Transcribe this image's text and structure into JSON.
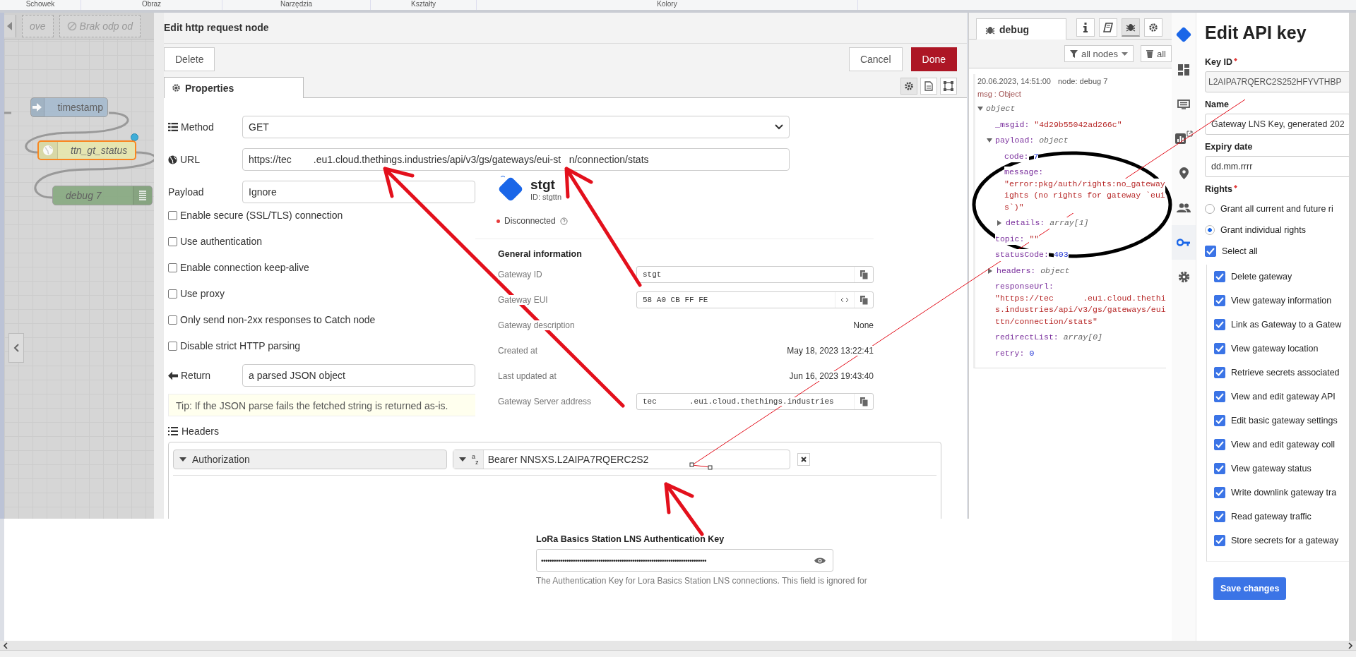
{
  "ribbon": {
    "groups": [
      "Schowek",
      "Obraz",
      "Narzędzia",
      "Kształty",
      "Kolory"
    ]
  },
  "flow_canvas": {
    "toolbar": [
      "ove",
      "Brak odp od"
    ],
    "nodes": [
      {
        "label": "timestamp",
        "kind": "inject",
        "selected": false,
        "changed": false
      },
      {
        "label": "ttn_gt_status",
        "kind": "http",
        "selected": true,
        "changed": true
      },
      {
        "label": "debug 7",
        "kind": "debug",
        "selected": false,
        "changed": false
      }
    ]
  },
  "edit_dialog": {
    "title": "Edit http request node",
    "buttons": [
      {
        "label": "Delete",
        "kind": "secondary"
      },
      {
        "label": "Cancel",
        "kind": "secondary"
      },
      {
        "label": "Done",
        "kind": "primary"
      }
    ],
    "tab": "Properties",
    "method": {
      "label": "Method",
      "value": "GET"
    },
    "url": {
      "label": "URL",
      "value": "https://tec        .eu1.cloud.thethings.industries/api/v3/gs/gateways/eui-st   n/connection/stats"
    },
    "payload": {
      "label": "Payload",
      "value": "Ignore"
    },
    "options": [
      {
        "label": "Enable secure (SSL/TLS) connection",
        "checked": false
      },
      {
        "label": "Use authentication",
        "checked": false
      },
      {
        "label": "Enable connection keep-alive",
        "checked": false
      },
      {
        "label": "Use proxy",
        "checked": false
      },
      {
        "label": "Only send non-2xx responses to Catch node",
        "checked": false
      },
      {
        "label": "Disable strict HTTP parsing",
        "checked": false
      }
    ],
    "return": {
      "label": "Return",
      "value": "a parsed JSON object"
    },
    "tip": "Tip: If the JSON parse fails the fetched string is returned as-is.",
    "headers": {
      "label": "Headers",
      "rows": [
        {
          "name": "Authorization",
          "type": "$^{a}$$_{z}$",
          "value": "Bearer NNSXS.L2AIPA7RQERC2S2"
        }
      ]
    }
  },
  "debug_panel": {
    "tab": "debug",
    "tools": [
      {
        "kind": "info",
        "selected": false
      },
      {
        "kind": "help",
        "selected": false
      },
      {
        "kind": "debug",
        "selected": true
      },
      {
        "kind": "config",
        "selected": false
      }
    ],
    "filter": "all nodes",
    "clear": "all",
    "message": {
      "time": "20.06.2023, 14:51:00",
      "node": "node: debug 7",
      "type": "msg : Object",
      "tree": [
        {
          "key": "object",
          "kind": "root",
          "expanded": true,
          "children": [
            {
              "key": "_msgid:",
              "value": "\"4d29b55042ad266c\"",
              "kind": "string"
            },
            {
              "key": "payload:",
              "value": "object",
              "kind": "type",
              "expanded": true,
              "children": [
                {
                  "key": "code:",
                  "value": "7",
                  "kind": "number"
                },
                {
                  "key": "message:",
                  "kind": "string",
                  "value_lines": [
                    "\"error:pkg/auth/rights:no_gateway",
                    "ights (no rights for gateway `eui",
                    "s`)\""
                  ]
                },
                {
                  "key": "details:",
                  "value": "array[1]",
                  "kind": "type",
                  "expanded": false
                }
              ]
            },
            {
              "key": "topic:",
              "value": "\"\"",
              "kind": "string"
            },
            {
              "key": "statusCode:",
              "value": "403",
              "kind": "number"
            },
            {
              "key": "headers:",
              "value": "object",
              "kind": "type",
              "expanded": false
            },
            {
              "key": "responseUrl:",
              "kind": "string",
              "value_lines": [
                "\"https://tec      .eu1.cloud.thethi",
                "s.industries/api/v3/gs/gateways/eui",
                "ttn/connection/stats\""
              ]
            },
            {
              "key": "redirectList:",
              "value": "array[0]",
              "kind": "type"
            },
            {
              "key": "retry:",
              "value": "0",
              "kind": "number"
            }
          ]
        }
      ]
    }
  },
  "gateway_overview": {
    "name": "stgt",
    "id": "ID: stgttn",
    "status": {
      "label": "Disconnected",
      "connected": false
    },
    "section": "General information",
    "rows": [
      {
        "label": "Gateway ID",
        "value": "stgt",
        "kind": "copy"
      },
      {
        "label": "Gateway EUI",
        "value": "58 A0 CB FF FE",
        "kind": "eui"
      },
      {
        "label": "Gateway description",
        "value": "None",
        "kind": "text"
      },
      {
        "label": "Created at",
        "value": "May 18, 2023 13:22:41",
        "kind": "text"
      },
      {
        "label": "Last updated at",
        "value": "Jun 16, 2023 19:43:40",
        "kind": "text"
      },
      {
        "label": "Gateway Server address",
        "value": "tec       .eu1.cloud.thethings.industries",
        "kind": "copy"
      }
    ]
  },
  "lns_key": {
    "label": "LoRa Basics Station LNS Authentication Key",
    "value": "••••••••••••••••••••••••••••••••••••••••••••••••••••••••••••••••••••••••••••••",
    "help": "The Authentication Key for Lora Basics Station LNS connections. This field is ignored for"
  },
  "api_key": {
    "sidebar": [
      {
        "kind": "dashboard",
        "selected": false
      },
      {
        "kind": "messages",
        "selected": false
      },
      {
        "kind": "analytics",
        "selected": false
      },
      {
        "kind": "location",
        "selected": false
      },
      {
        "kind": "people",
        "selected": false
      },
      {
        "kind": "key",
        "selected": true
      },
      {
        "kind": "settings",
        "selected": false
      }
    ],
    "title": "Edit API key",
    "key_id": {
      "label": "Key ID",
      "required": true,
      "value": "L2AIPA7RQERC2S252HFYVTHBP"
    },
    "name": {
      "label": "Name",
      "value": "Gateway LNS Key, generated 202"
    },
    "expiry": {
      "label": "Expiry date",
      "placeholder": "dd.mm.rrrr"
    },
    "rights": {
      "label": "Rights",
      "required": true,
      "options": [
        {
          "label": "Grant all current and future ri",
          "selected": false
        },
        {
          "label": "Grant individual rights",
          "selected": true
        }
      ],
      "select_all": {
        "label": "Select all",
        "checked": true
      },
      "items": [
        {
          "label": "Delete gateway",
          "checked": true
        },
        {
          "label": "View gateway information",
          "checked": true
        },
        {
          "label": "Link as Gateway to a Gatew",
          "checked": true
        },
        {
          "label": "View gateway location",
          "checked": true
        },
        {
          "label": "Retrieve secrets associated",
          "checked": true
        },
        {
          "label": "View and edit gateway API",
          "checked": true
        },
        {
          "label": "Edit basic gateway settings",
          "checked": true
        },
        {
          "label": "View and edit gateway coll",
          "checked": true
        },
        {
          "label": "View gateway status",
          "checked": true
        },
        {
          "label": "Write downlink gateway tra",
          "checked": true
        },
        {
          "label": "Read gateway traffic",
          "checked": true
        },
        {
          "label": "Store secrets for a gateway",
          "checked": true
        }
      ]
    },
    "save": "Save changes"
  }
}
